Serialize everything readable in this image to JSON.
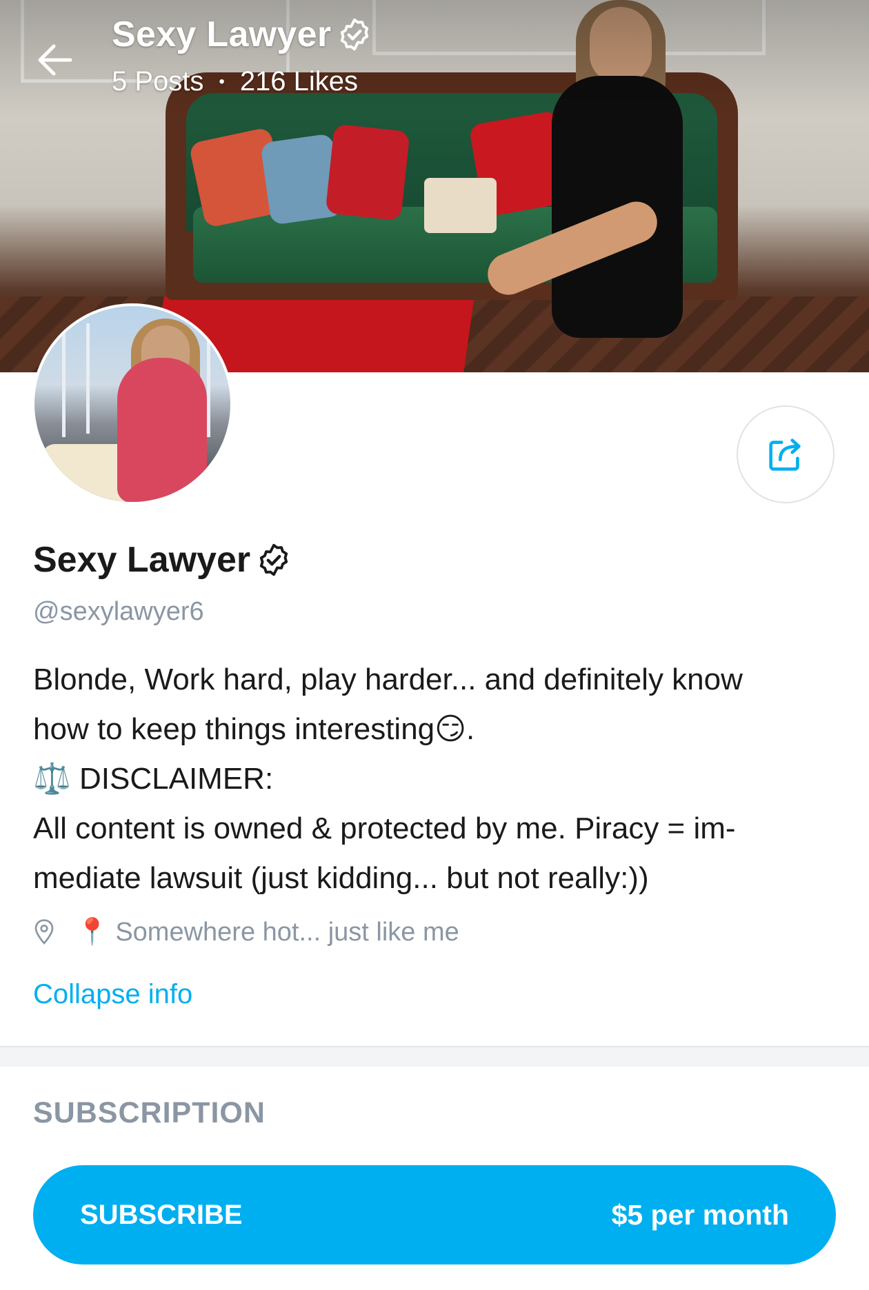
{
  "header": {
    "title": "Sexy Lawyer",
    "posts": "5 Posts",
    "separator": "•",
    "likes": "216 Likes"
  },
  "profile": {
    "name": "Sexy Lawyer",
    "handle": "@sexylawyer6",
    "bio_lines": [
      "Blonde, Work hard, play harder... and definitely know",
      "how to keep things interesting😏.",
      "⚖️ DISCLAIMER:",
      "All content is owned & protected by me. Piracy = im-",
      "mediate lawsuit (just kidding... but not really:))"
    ],
    "location_emoji": "📍",
    "location": "Somewhere hot... just like me",
    "collapse_label": "Collapse info"
  },
  "subscription": {
    "section_title": "SUBSCRIPTION",
    "button_label": "SUBSCRIBE",
    "price": "$5 per month"
  },
  "colors": {
    "accent": "#00aff0",
    "muted_text": "#8a96a3",
    "primary_text": "#1a1a1a"
  },
  "icons": {
    "back": "arrow-left-icon",
    "verified": "verified-badge-icon",
    "share": "share-icon",
    "location": "location-pin-icon"
  }
}
